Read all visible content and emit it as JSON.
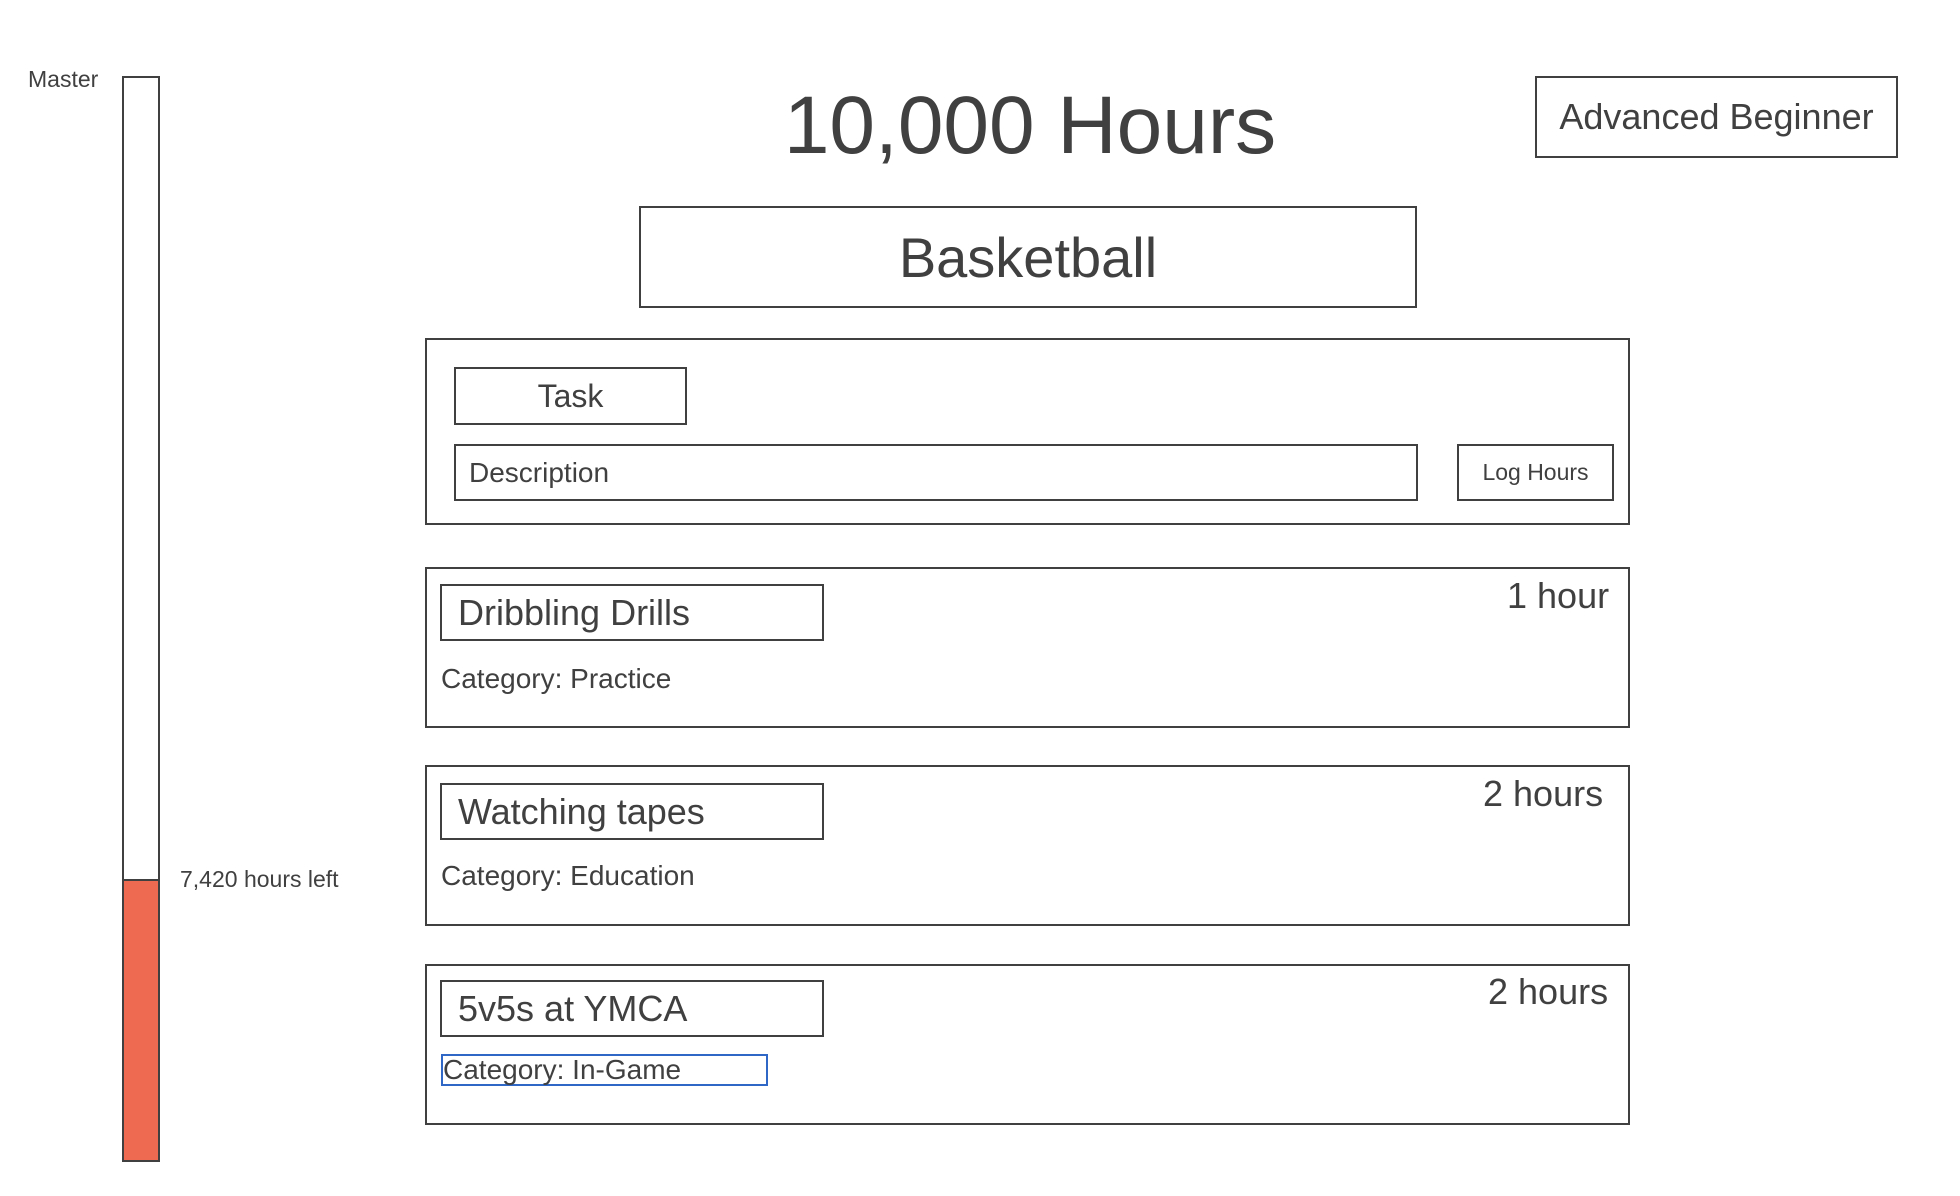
{
  "progress": {
    "top_label": "Master",
    "hours_left_label": "7,420 hours left",
    "fraction_complete": 0.258,
    "fill_color": "#ee6b52"
  },
  "header": {
    "title": "10,000 Hours",
    "level": "Advanced Beginner",
    "skill": "Basketball"
  },
  "log_form": {
    "task_placeholder": "Task",
    "description_placeholder": "Description",
    "submit_label": "Log Hours"
  },
  "entries": [
    {
      "name": "Dribbling Drills",
      "hours": "1 hour",
      "category": "Category: Practice"
    },
    {
      "name": "Watching tapes",
      "hours": "2 hours",
      "category": "Category: Education"
    },
    {
      "name": "5v5s at YMCA",
      "hours": "2 hours",
      "category": "Category: In-Game"
    }
  ],
  "colors": {
    "text": "#404040",
    "selection_outline": "#2f67c6"
  }
}
